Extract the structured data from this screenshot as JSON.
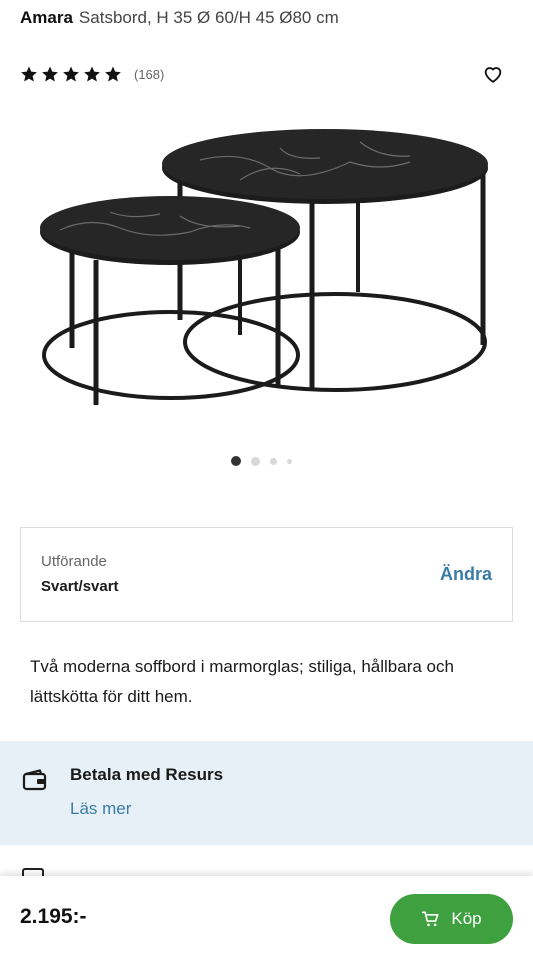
{
  "product": {
    "brand": "Amara",
    "subtitle": "Satsbord, H 35 Ø 60/H 45 Ø80 cm",
    "rating_stars": 5,
    "review_count": "(168)",
    "description": "Två moderna soffbord i marmorglas; stiliga, hållbara och lättskötta för ditt hem."
  },
  "gallery": {
    "image_count": 4,
    "active_index": 0
  },
  "variant": {
    "label": "Utförande",
    "value": "Svart/svart",
    "change_label": "Ändra"
  },
  "payment": {
    "title": "Betala med Resurs",
    "link": "Läs mer"
  },
  "purchase": {
    "price": "2.195:-",
    "buy_label": "Köp"
  },
  "colors": {
    "accent_link": "#3a7ca5",
    "buy_button": "#3ea03f",
    "payment_banner_bg": "#e6f0f6"
  },
  "icons": {
    "favorite": "heart-icon",
    "payment": "wallet-icon",
    "buy": "cart-icon",
    "rating": "star-icon"
  }
}
